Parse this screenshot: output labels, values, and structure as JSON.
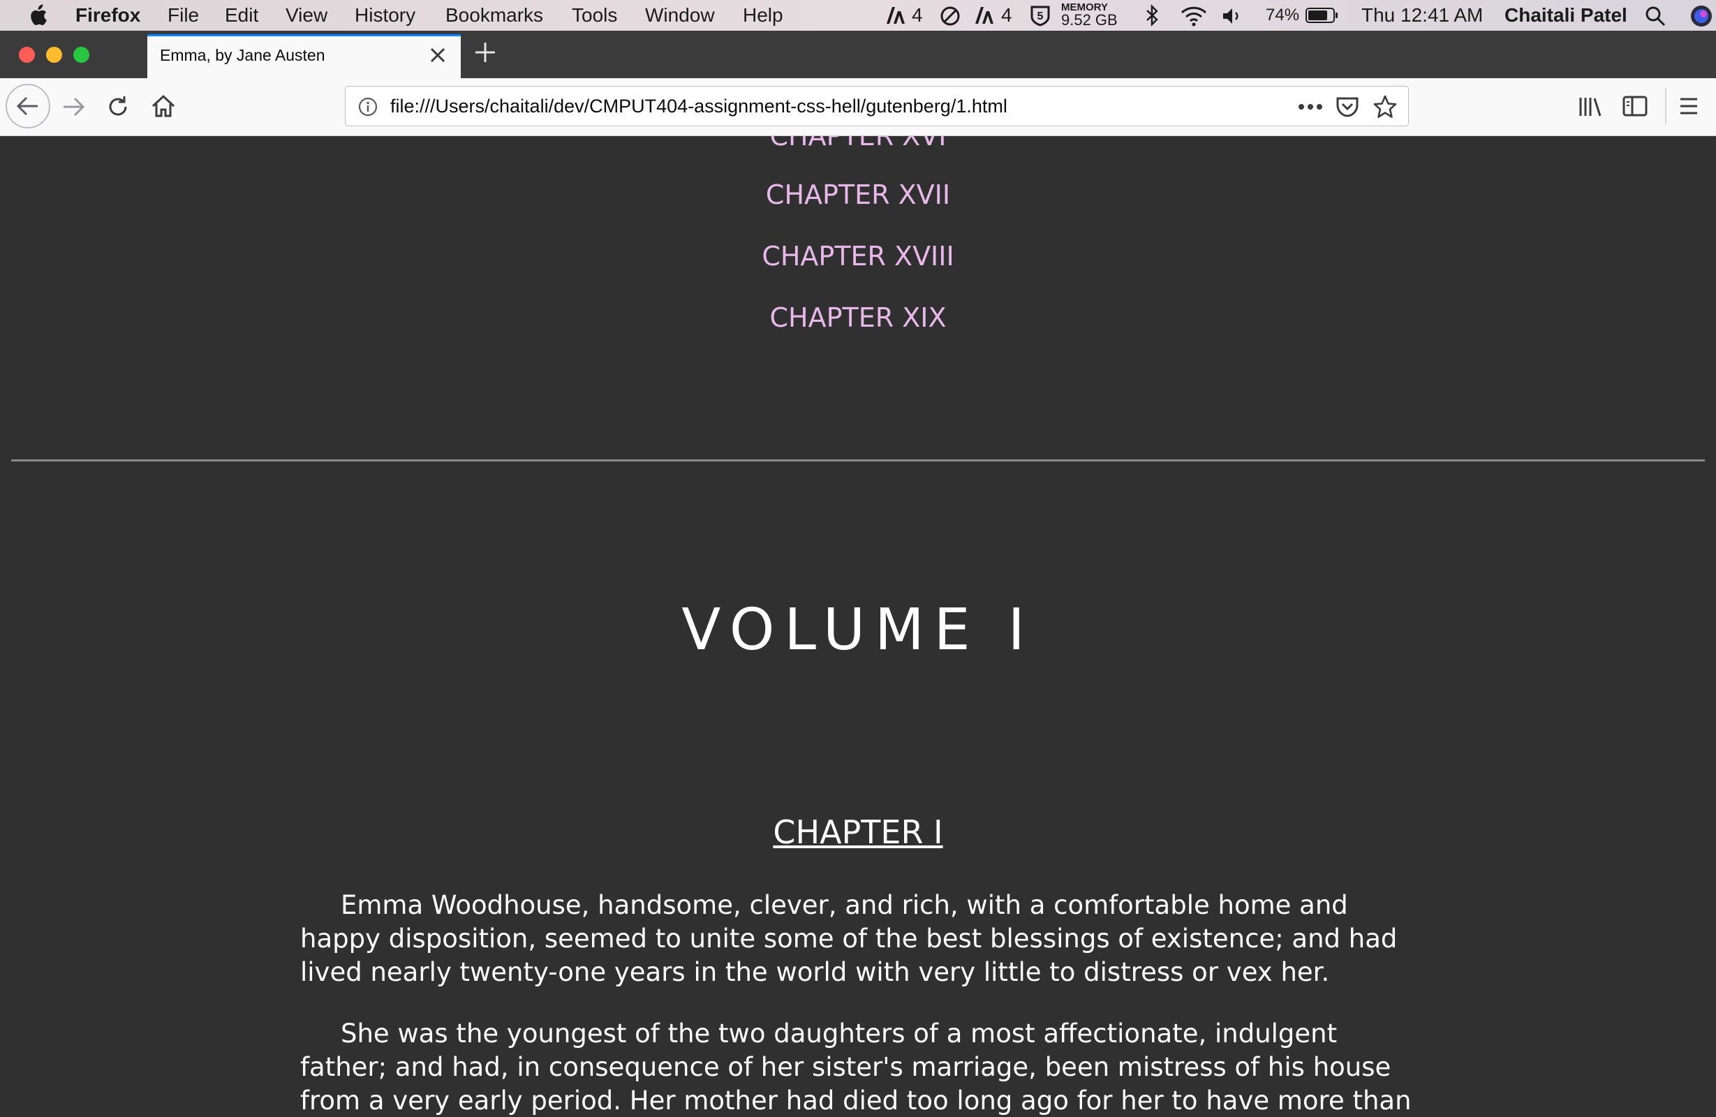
{
  "menubar": {
    "app": "Firefox",
    "items": [
      "File",
      "Edit",
      "View",
      "History",
      "Bookmarks",
      "Tools",
      "Window",
      "Help"
    ],
    "status": {
      "adobe1_count": "4",
      "adobe2_count": "4",
      "memory_label": "MEMORY",
      "memory_value": "9.52 GB",
      "battery": "74%",
      "clock": "Thu 12:41 AM",
      "user": "Chaitali Patel"
    }
  },
  "tab": {
    "title": "Emma, by Jane Austen"
  },
  "urlbar": {
    "url": "file:///Users/chaitali/dev/CMPUT404-assignment-css-hell/gutenberg/1.html"
  },
  "page": {
    "toc": [
      "CHAPTER XVI",
      "CHAPTER XVII",
      "CHAPTER XVIII",
      "CHAPTER XIX"
    ],
    "volume_title": "VOLUME I",
    "chapter_title": "CHAPTER I",
    "paragraphs": [
      "Emma Woodhouse, handsome, clever, and rich, with a comfortable home and happy disposition, seemed to unite some of the best blessings of existence; and had lived nearly twenty-one years in the world with very little to distress or vex her.",
      "She was the youngest of the two daughters of a most affectionate, indulgent father; and had, in consequence of her sister's marriage, been mistress of his house from a very early period. Her mother had died too long ago for her to have more than an indistinct"
    ],
    "link_color": "#e9b8ea",
    "background_color": "#303030"
  },
  "icons": {
    "menubar": [
      "apple-icon",
      "adobe-icon",
      "sync-icon",
      "adobe-icon",
      "istat-icon",
      "bluetooth-icon",
      "wifi-icon",
      "volume-icon",
      "battery-icon",
      "spotlight-icon",
      "siri-icon"
    ],
    "toolbar": [
      "back-icon",
      "forward-icon",
      "reload-icon",
      "home-icon",
      "info-icon",
      "more-icon",
      "pocket-icon",
      "star-icon",
      "library-icon",
      "sidebar-icon",
      "menu-icon"
    ]
  }
}
